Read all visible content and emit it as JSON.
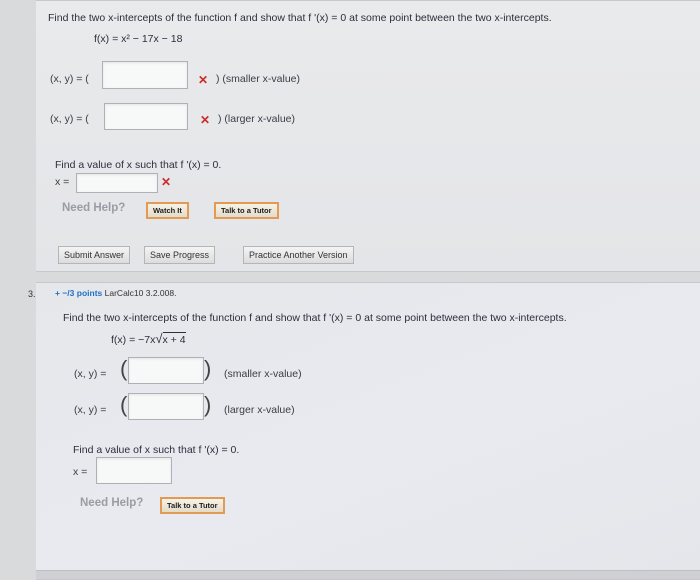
{
  "q2": {
    "prompt": "Find the two x-intercepts of the function f and show that f '(x) = 0 at some point between the two x-intercepts.",
    "function": "f(x) = x² − 17x − 18",
    "row1_label": "(x, y) = (",
    "row1_tail": ") (smaller x-value)",
    "row2_label": "(x, y) = (",
    "row2_tail": ") (larger x-value)",
    "find_prompt": "Find a value of x such that f '(x) = 0.",
    "x_label": "x =",
    "need_help": "Need Help?",
    "watch_it": "Watch It",
    "talk_to_tutor": "Talk to a Tutor",
    "submit_answer": "Submit Answer",
    "save_progress": "Save Progress",
    "practice_another": "Practice Another Version",
    "wrong_mark": "✕"
  },
  "q3": {
    "number": "3.",
    "points": "−/3 points",
    "code": "LarCalc10 3.2.008.",
    "prompt": "Find the two x-intercepts of the function f and show that f '(x) = 0 at some point between the two x-intercepts.",
    "fx_left": "f(x) = −7x",
    "fx_radicand": "x + 4",
    "row1_label": "(x, y) =",
    "row1_tail": "(smaller x-value)",
    "row2_label": "(x, y) =",
    "row2_tail": "(larger x-value)",
    "find_prompt": "Find a value of x such that f '(x) = 0.",
    "x_label": "x =",
    "need_help": "Need Help?",
    "talk_to_tutor": "Talk to a Tutor"
  }
}
